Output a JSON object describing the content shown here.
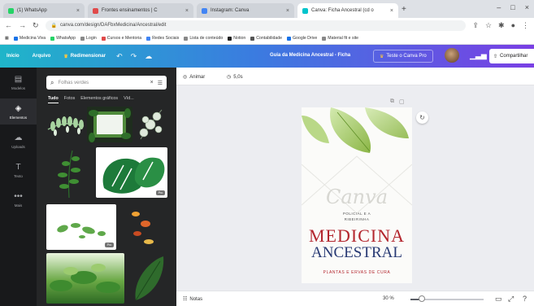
{
  "browser": {
    "tabs": [
      {
        "label": "(1) WhatsApp",
        "color": "#25d366",
        "active": false
      },
      {
        "label": "Frontes ensinamentos | C",
        "color": "#e04a4a",
        "active": false
      },
      {
        "label": "Instagram: Canva",
        "color": "#4285f4",
        "active": false
      },
      {
        "label": "Canva: Ficha Ancestral (cd o",
        "color": "#00c4cc",
        "active": true
      }
    ],
    "new_tab": "+",
    "address": "canva.com/design/DAFbxMedicina/Ancestral/edit",
    "bookmarks": [
      {
        "label": "Medicina Viva",
        "color": "#1a73e8"
      },
      {
        "label": "WhatsApp",
        "color": "#25d366"
      },
      {
        "label": "Login",
        "color": "#888888"
      },
      {
        "label": "Cursos e Mentoria",
        "color": "#e04a4a"
      },
      {
        "label": "Redes Sociais",
        "color": "#4285f4"
      },
      {
        "label": "Lista de conteúdo",
        "color": "#888888"
      },
      {
        "label": "Notion",
        "color": "#222222"
      },
      {
        "label": "Contabilidade",
        "color": "#555555"
      },
      {
        "label": "Google Drive",
        "color": "#1a73e8"
      },
      {
        "label": "Material fit e site",
        "color": "#888888"
      }
    ]
  },
  "editor": {
    "home": "Início",
    "file": "Arquivo",
    "resize": "Redimensionar",
    "doc_title": "Guia da Medicina Ancestral - Ficha",
    "pro_button": "Teste o Canva Pro",
    "share": "Compartilhar"
  },
  "sidebar": [
    {
      "label": "Modelos",
      "icon": "template-icon",
      "active": false
    },
    {
      "label": "Elementos",
      "icon": "elements-icon",
      "active": true
    },
    {
      "label": "Uploads",
      "icon": "upload-icon",
      "active": false
    },
    {
      "label": "Texto",
      "icon": "text-icon",
      "active": false
    },
    {
      "label": "Mais",
      "icon": "more-icon",
      "active": false
    }
  ],
  "panel": {
    "search_placeholder": "Folhas verdes",
    "filters": [
      "Tudo",
      "Fotos",
      "Elementos gráficos",
      "Víd..."
    ],
    "thumb_badge": "Pro"
  },
  "canvas": {
    "animate": "Animar",
    "duration": "5,0s",
    "design": {
      "script": "Canva",
      "subtitle_line1": "POLICIAL E A",
      "subtitle_line2": "RIBEIRINHA",
      "title_line1": "MEDICINA",
      "title_line2": "ANCESTRAL",
      "footer": "PLANTAS E ERVAS DE CURA"
    },
    "accent_green": "#7fae32",
    "title_red": "#b3262e",
    "title_blue": "#283a74"
  },
  "bottom": {
    "notes": "Notas",
    "zoom_percent": "30 %",
    "zoom_level": 0.15
  }
}
